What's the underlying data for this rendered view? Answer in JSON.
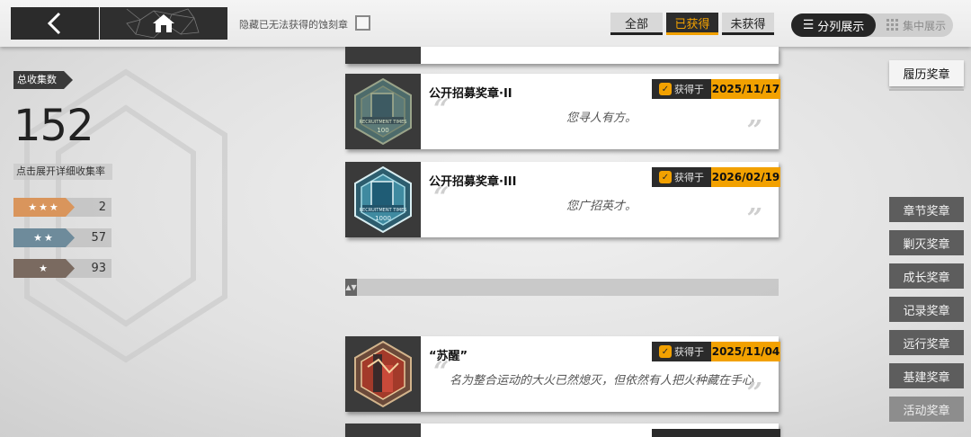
{
  "top_bar": {
    "back_icon": "chevron-left-icon",
    "home_icon": "home-icon",
    "hide_unobtainable_label": "隐藏已无法获得的蚀刻章",
    "filters": {
      "all": "全部",
      "obtained": "已获得",
      "not_obtained": "未获得",
      "selected": "已获得"
    },
    "view": {
      "split": "分列展示",
      "grouped": "集中展示",
      "selected": "分列展示"
    }
  },
  "stats": {
    "total_label": "总收集数",
    "total_value": "152",
    "expand_hint": "点击展开详细收集率",
    "rates": [
      {
        "stars": "★★★",
        "value": "2",
        "color": "#d9955c"
      },
      {
        "stars": "★★",
        "value": "57",
        "color": "#6e8b9b"
      },
      {
        "stars": "★",
        "value": "93",
        "color": "#7a6a60"
      }
    ]
  },
  "cards": [
    {
      "title": "公开招募奖章·II",
      "quote": "您寻人有方。",
      "obtained_label": "获得于",
      "date": "2025/11/17",
      "icon": "recruitment-medal-icon"
    },
    {
      "title": "公开招募奖章·III",
      "quote": "您广招英才。",
      "obtained_label": "获得于",
      "date": "2026/02/19",
      "icon": "recruitment-medal-icon"
    },
    {
      "title": "“苏醒”",
      "quote": "名为整合运动的大火已然熄灭，但依然有人把火种藏在手心",
      "obtained_label": "获得于",
      "date": "2025/11/04",
      "icon": "awakening-medal-icon"
    }
  ],
  "categories": {
    "active": "履历奖章",
    "items": [
      "章节奖章",
      "剿灭奖章",
      "成长奖章",
      "记录奖章",
      "远行奖章",
      "基建奖章",
      "活动奖章"
    ]
  },
  "colors": {
    "accent": "#f2a100",
    "dark": "#2b2b2b"
  }
}
